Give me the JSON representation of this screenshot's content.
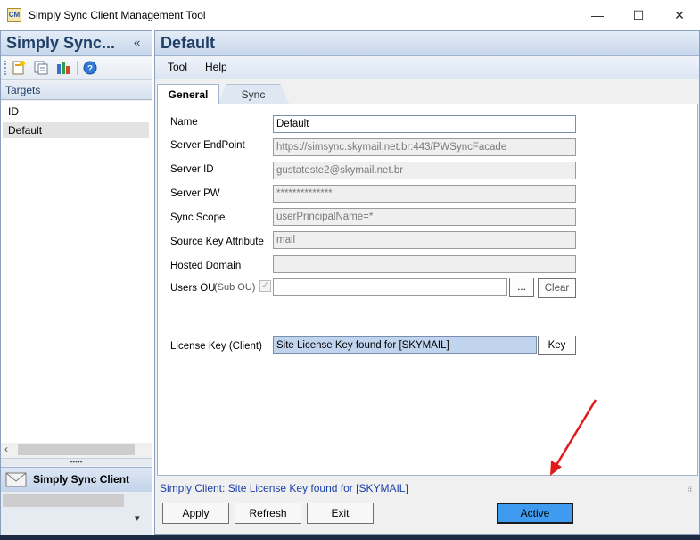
{
  "window": {
    "title": "Simply Sync Client Management Tool",
    "icon_text": "CM",
    "minimize_glyph": "—",
    "maximize_glyph": "☐",
    "close_glyph": "✕"
  },
  "left": {
    "title": "Simply Sync...",
    "collapse_glyph": "«",
    "targets_label": "Targets",
    "tree_items": [
      "ID",
      "Default"
    ],
    "selected_item": "Default",
    "scroll_left_glyph": "‹",
    "splitter_glyph": "•••••",
    "nav_label": "Simply Sync Client",
    "nav_dropdown_glyph": "▾"
  },
  "right": {
    "title": "Default",
    "menu": [
      "Tool",
      "Help"
    ],
    "tabs": [
      "General",
      "Sync"
    ],
    "fields": {
      "name": {
        "label": "Name",
        "value": "Default"
      },
      "endpoint": {
        "label": "Server EndPoint",
        "value": "https://simsync.skymail.net.br:443/PWSyncFacade"
      },
      "server_id": {
        "label": "Server ID",
        "value": "gustateste2@skymail.net.br"
      },
      "server_pw": {
        "label": "Server PW",
        "value": "**************"
      },
      "sync_scope": {
        "label": "Sync Scope",
        "value": "userPrincipalName=*"
      },
      "source_key": {
        "label": "Source Key Attribute",
        "value": "mail"
      },
      "hosted_domain": {
        "label": "Hosted Domain",
        "value": ""
      },
      "users_ou": {
        "label": "Users OU",
        "sub_label": "(Sub OU)",
        "value": "",
        "checked": true,
        "browse_label": "...",
        "clear_label": "Clear"
      },
      "license_key": {
        "label": "License Key (Client)",
        "value": "Site License Key found for [SKYMAIL]",
        "button_label": "Key"
      }
    },
    "status_text": "Simply Client: Site License Key found for [SKYMAIL]",
    "grip_glyph": "⠿",
    "buttons": {
      "apply": "Apply",
      "refresh": "Refresh",
      "exit": "Exit",
      "active": "Active"
    }
  },
  "annotation": {
    "arrow_color": "#e01b1b"
  },
  "colors": {
    "accent_blue": "#3f9bf0",
    "header_text": "#1f3f66",
    "status_text": "#1a3fa8",
    "license_field_bg": "#c0d4ee"
  }
}
